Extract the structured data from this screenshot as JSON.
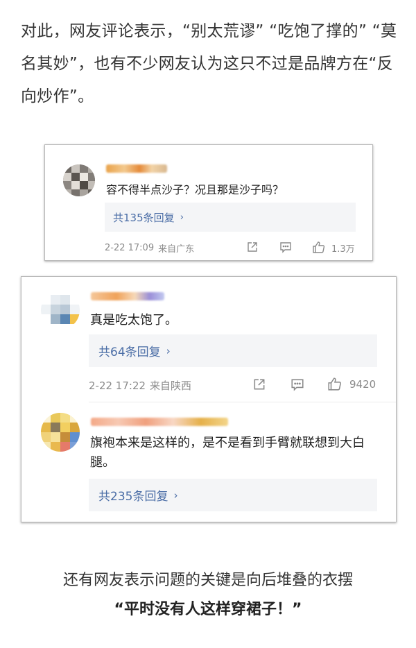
{
  "intro_text": "对此，网友评论表示，“别太荒谬” “吃饱了撑的” “莫名其妙”，也有不少网友认为这只不过是品牌方在“反向炒作”。",
  "comment1": {
    "text": "容不得半点沙子？况且那是沙子吗？",
    "reply_label": "共135条回复",
    "date": "2-22 17:09",
    "location": "来自广东",
    "likes": "1.3万"
  },
  "comment2": {
    "text": "真是吃太饱了。",
    "reply_label": "共64条回复",
    "date": "2-22 17:22",
    "location": "来自陕西",
    "likes": "9420"
  },
  "comment3": {
    "text": "旗袍本来是这样的，是不是看到手臂就联想到大白腿。",
    "reply_label": "共235条回复"
  },
  "outro_line1": "还有网友表示问题的关键是向后堆叠的衣摆",
  "outro_line2": "“平时没有人这样穿裙子！”",
  "icons": [
    "share-icon",
    "comment-icon",
    "like-icon",
    "chevron-right-icon"
  ],
  "colors": {
    "reply_link": "#4a6da6",
    "meta_gray": "#8a8a8a",
    "reply_bg": "#f4f5f7"
  }
}
